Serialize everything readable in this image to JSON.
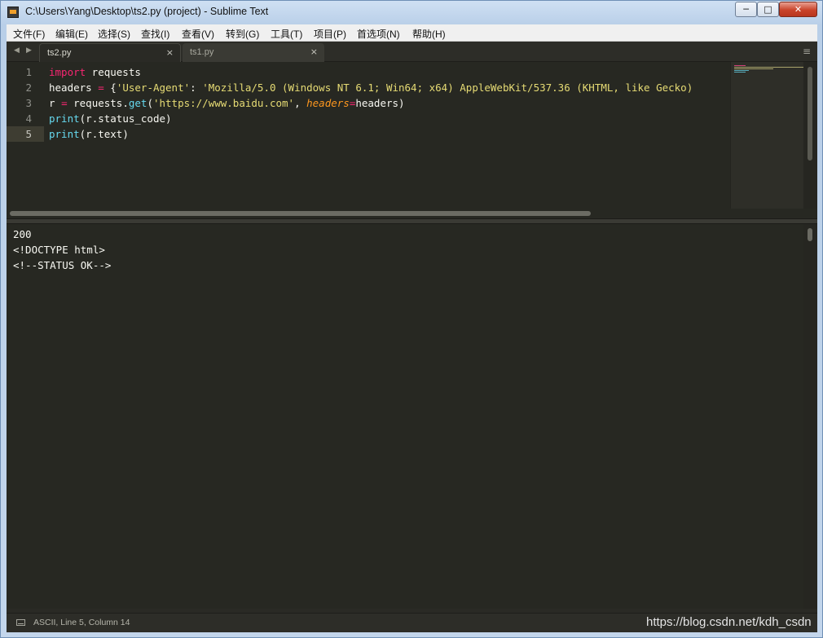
{
  "window": {
    "title": "C:\\Users\\Yang\\Desktop\\ts2.py (project) - Sublime Text",
    "minimize_glyph": "─",
    "maximize_glyph": "□",
    "close_glyph": "✕"
  },
  "menu": {
    "items": [
      {
        "label": "文件(F)"
      },
      {
        "label": "编辑(E)"
      },
      {
        "label": "选择(S)"
      },
      {
        "label": "查找(I)"
      },
      {
        "label": "查看(V)"
      },
      {
        "label": "转到(G)"
      },
      {
        "label": "工具(T)"
      },
      {
        "label": "项目(P)"
      },
      {
        "label": "首选项(N)"
      },
      {
        "label": "帮助(H)"
      }
    ]
  },
  "tabs": {
    "nav_prev": "◀",
    "nav_next": "▶",
    "items": [
      {
        "label": "ts2.py",
        "close": "×",
        "active": true
      },
      {
        "label": "ts1.py",
        "close": "×",
        "active": false
      }
    ],
    "menu_glyph": "≡"
  },
  "editor": {
    "line_numbers": [
      "1",
      "2",
      "3",
      "4",
      "5"
    ],
    "current_line": 5,
    "lines": [
      {
        "tokens": [
          {
            "t": "import",
            "c": "kw"
          },
          {
            "t": " requests",
            "c": ""
          }
        ]
      },
      {
        "tokens": [
          {
            "t": "headers ",
            "c": ""
          },
          {
            "t": "=",
            "c": "op"
          },
          {
            "t": " {",
            "c": ""
          },
          {
            "t": "'User-Agent'",
            "c": "str"
          },
          {
            "t": ": ",
            "c": ""
          },
          {
            "t": "'Mozilla/5.0 (Windows NT 6.1; Win64; x64) AppleWebKit/537.36 (KHTML, like Gecko)",
            "c": "str"
          }
        ]
      },
      {
        "tokens": [
          {
            "t": "r ",
            "c": ""
          },
          {
            "t": "=",
            "c": "op"
          },
          {
            "t": " requests.",
            "c": ""
          },
          {
            "t": "get",
            "c": "fn"
          },
          {
            "t": "(",
            "c": ""
          },
          {
            "t": "'https://www.baidu.com'",
            "c": "str"
          },
          {
            "t": ", ",
            "c": ""
          },
          {
            "t": "headers",
            "c": "param"
          },
          {
            "t": "=",
            "c": "op"
          },
          {
            "t": "headers)",
            "c": ""
          }
        ]
      },
      {
        "tokens": [
          {
            "t": "print",
            "c": "fn"
          },
          {
            "t": "(r.status_code)",
            "c": ""
          }
        ]
      },
      {
        "tokens": [
          {
            "t": "print",
            "c": "fn"
          },
          {
            "t": "(r.text)",
            "c": ""
          }
        ]
      }
    ]
  },
  "output": {
    "lines": [
      "200",
      "<!DOCTYPE html>",
      "<!--STATUS OK-->"
    ]
  },
  "status": {
    "text": "ASCII, Line 5, Column 14",
    "watermark": "https://blog.csdn.net/kdh_csdn"
  }
}
